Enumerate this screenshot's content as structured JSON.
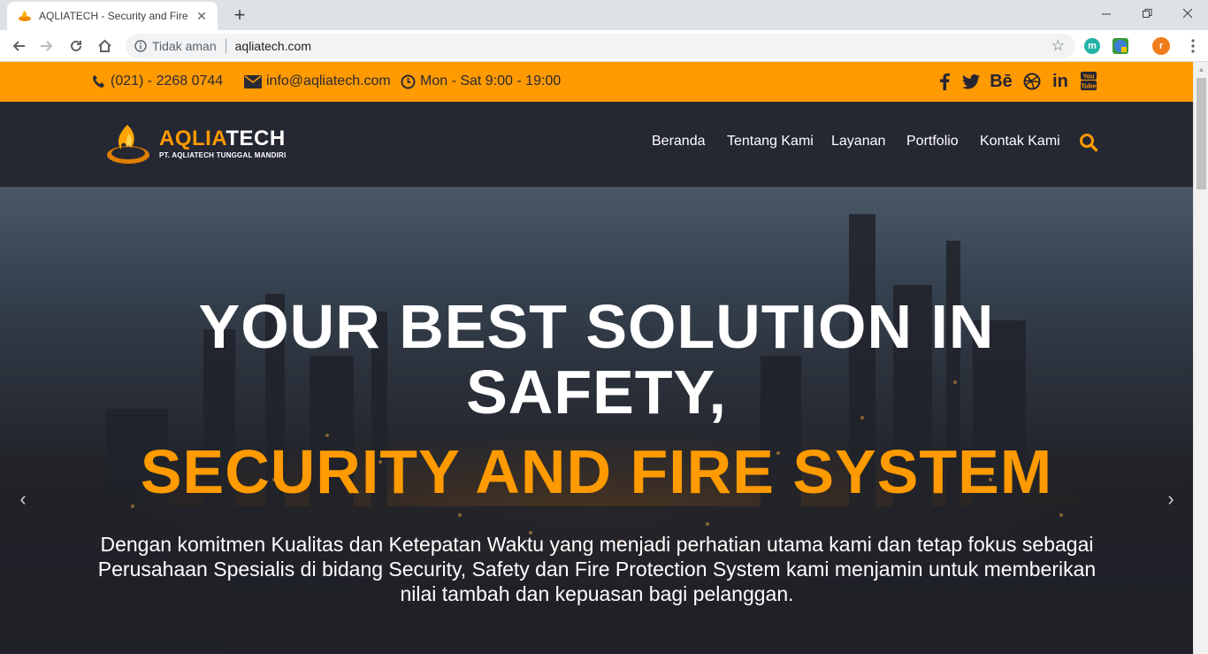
{
  "browser": {
    "tab_title": "AQLIATECH - Security and Fire Sy",
    "security_label": "Tidak aman",
    "url": "aqliatech.com",
    "new_tab": "+",
    "extensions": [
      {
        "name": "m",
        "color": "#22b3a7"
      },
      {
        "name": "r",
        "color": "#f07c1b"
      }
    ]
  },
  "topbar": {
    "phone": "(021) - 2268 0744",
    "email": "info@aqliatech.com",
    "hours": "Mon - Sat 9:00 - 19:00",
    "social": [
      "facebook-icon",
      "twitter-icon",
      "behance-icon",
      "dribbble-icon",
      "linkedin-icon",
      "youtube-icon"
    ],
    "behance_text": "Bē",
    "linkedin_text": "in",
    "accent_color": "#ff9a00"
  },
  "logo": {
    "name_accent": "AQLIA",
    "name_rest": "TECH",
    "subtitle": "PT. AQLIATECH TUNGGAL MANDIRI"
  },
  "nav": {
    "items": [
      "Beranda",
      "Tentang Kami",
      "Layanan",
      "Portfolio",
      "Kontak Kami"
    ]
  },
  "hero": {
    "line1": "YOUR BEST SOLUTION IN",
    "line2": "SAFETY,",
    "line3": "SECURITY AND FIRE SYSTEM",
    "description": "Dengan komitmen Kualitas dan Ketepatan Waktu yang menjadi perhatian utama kami dan tetap fokus sebagai Perusahaan Spesialis di bidang Security, Safety dan Fire Protection System kami menjamin untuk memberikan nilai tambah dan kepuasan bagi pelanggan.",
    "prev": "‹",
    "next": "›"
  }
}
